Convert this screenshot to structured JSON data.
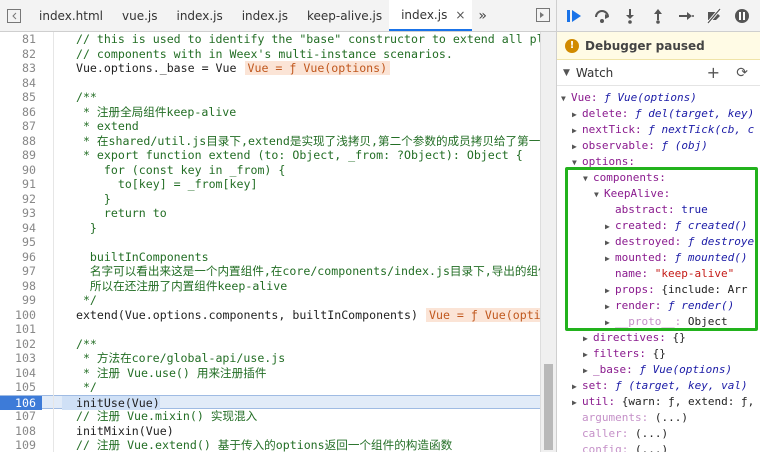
{
  "tabs": [
    {
      "label": "index.html",
      "active": false
    },
    {
      "label": "vue.js",
      "active": false
    },
    {
      "label": "index.js",
      "active": false
    },
    {
      "label": "index.js",
      "active": false
    },
    {
      "label": "keep-alive.js",
      "active": false
    },
    {
      "label": "index.js",
      "active": true
    }
  ],
  "tab_close": "×",
  "tab_more": "»",
  "code_lines": [
    {
      "n": "81",
      "text": "  // this is used to identify the \"base\" constructor to extend all plain-ob",
      "cls": "c-comment"
    },
    {
      "n": "82",
      "text": "  // components with in Weex's multi-instance scenarios.",
      "cls": "c-comment"
    },
    {
      "n": "83",
      "text": "  Vue.options._base = Vue",
      "cls": "",
      "inline": "Vue = ƒ Vue(options)"
    },
    {
      "n": "84",
      "text": "",
      "cls": ""
    },
    {
      "n": "85",
      "text": "  /**",
      "cls": "c-comment"
    },
    {
      "n": "86",
      "text": "   * 注册全局组件keep-alive",
      "cls": "c-comment"
    },
    {
      "n": "87",
      "text": "   * extend",
      "cls": "c-comment"
    },
    {
      "n": "88",
      "text": "   * 在shared/util.js目录下,extend是实现了浅拷贝,第二个参数的成员拷贝给了第一个参",
      "cls": "c-comment"
    },
    {
      "n": "89",
      "text": "   * export function extend (to: Object, _from: ?Object): Object {",
      "cls": "c-comment"
    },
    {
      "n": "90",
      "text": "      for (const key in _from) {",
      "cls": "c-comment"
    },
    {
      "n": "91",
      "text": "        to[key] = _from[key]",
      "cls": "c-comment"
    },
    {
      "n": "92",
      "text": "      }",
      "cls": "c-comment"
    },
    {
      "n": "93",
      "text": "      return to",
      "cls": "c-comment"
    },
    {
      "n": "94",
      "text": "    }",
      "cls": "c-comment"
    },
    {
      "n": "95",
      "text": "",
      "cls": ""
    },
    {
      "n": "96",
      "text": "    builtInComponents",
      "cls": "c-comment"
    },
    {
      "n": "97",
      "text": "    名字可以看出来这是一个内置组件,在core/components/index.js目录下,导出的组件其",
      "cls": "c-comment"
    },
    {
      "n": "98",
      "text": "    所以在还注册了内置组件keep-alive",
      "cls": "c-comment"
    },
    {
      "n": "99",
      "text": "   */",
      "cls": "c-comment"
    },
    {
      "n": "100",
      "text": "  extend(Vue.options.components, builtInComponents)",
      "cls": "",
      "inline": "Vue = ƒ Vue(options)"
    },
    {
      "n": "101",
      "text": "",
      "cls": ""
    },
    {
      "n": "102",
      "text": "  /**",
      "cls": "c-comment"
    },
    {
      "n": "103",
      "text": "   * 方法在core/global-api/use.js",
      "cls": "c-comment"
    },
    {
      "n": "104",
      "text": "   * 注册 Vue.use() 用来注册插件",
      "cls": "c-comment"
    },
    {
      "n": "105",
      "text": "   */",
      "cls": "c-comment"
    },
    {
      "n": "106",
      "text": "  initUse(Vue)",
      "cls": "",
      "hl": true
    },
    {
      "n": "107",
      "text": "  // 注册 Vue.mixin() 实现混入",
      "cls": "c-comment"
    },
    {
      "n": "108",
      "text": "  initMixin(Vue)",
      "cls": ""
    },
    {
      "n": "109",
      "text": "  // 注册 Vue.extend() 基于传入的options返回一个组件的构造函数",
      "cls": "c-comment"
    },
    {
      "n": "110",
      "text": "  initExtend(Vue)",
      "cls": ""
    }
  ],
  "debugger": {
    "paused_label": "Debugger paused",
    "watch_label": "Watch",
    "plus": "+",
    "refresh": "⟳"
  },
  "watch_tree": [
    {
      "indent": 0,
      "arrow": "▼",
      "key": "Vue:",
      "val": "ƒ Vue(options)",
      "valcls": "fn"
    },
    {
      "indent": 1,
      "arrow": "▶",
      "key": "delete:",
      "val": "ƒ del(target, key)",
      "valcls": "fn"
    },
    {
      "indent": 1,
      "arrow": "▶",
      "key": "nextTick:",
      "val": "ƒ nextTick(cb, c",
      "valcls": "fn"
    },
    {
      "indent": 1,
      "arrow": "▶",
      "key": "observable:",
      "val": "ƒ (obj)",
      "valcls": "fn"
    },
    {
      "indent": 1,
      "arrow": "▼",
      "key": "options:",
      "val": "",
      "valcls": "plain"
    },
    {
      "indent": 2,
      "arrow": "▼",
      "key": "components:",
      "val": "",
      "valcls": "plain"
    },
    {
      "indent": 3,
      "arrow": "▼",
      "key": "KeepAlive:",
      "val": "",
      "valcls": "plain"
    },
    {
      "indent": 4,
      "arrow": "",
      "key": "abstract:",
      "val": "true",
      "valcls": "b"
    },
    {
      "indent": 4,
      "arrow": "▶",
      "key": "created:",
      "val": "ƒ created()",
      "valcls": "fn"
    },
    {
      "indent": 4,
      "arrow": "▶",
      "key": "destroyed:",
      "val": "ƒ destroye",
      "valcls": "fn"
    },
    {
      "indent": 4,
      "arrow": "▶",
      "key": "mounted:",
      "val": "ƒ mounted()",
      "valcls": "fn"
    },
    {
      "indent": 4,
      "arrow": "",
      "key": "name:",
      "val": "\"keep-alive\"",
      "valcls": "s"
    },
    {
      "indent": 4,
      "arrow": "▶",
      "key": "props:",
      "val": "{include: Arr",
      "valcls": "plain"
    },
    {
      "indent": 4,
      "arrow": "▶",
      "key": "render:",
      "val": "ƒ render()",
      "valcls": "fn"
    },
    {
      "indent": 4,
      "arrow": "▶",
      "key": "__proto__:",
      "val": "Object",
      "valcls": "plain",
      "dim": true
    },
    {
      "indent": 2,
      "arrow": "▶",
      "key": "directives:",
      "val": "{}",
      "valcls": "plain"
    },
    {
      "indent": 2,
      "arrow": "▶",
      "key": "filters:",
      "val": "{}",
      "valcls": "plain"
    },
    {
      "indent": 2,
      "arrow": "▶",
      "key": "_base:",
      "val": "ƒ Vue(options)",
      "valcls": "fn"
    },
    {
      "indent": 1,
      "arrow": "▶",
      "key": "set:",
      "val": "ƒ (target, key, val)",
      "valcls": "fn"
    },
    {
      "indent": 1,
      "arrow": "▶",
      "key": "util:",
      "val": "{warn: ƒ, extend: ƒ,",
      "valcls": "plain"
    },
    {
      "indent": 1,
      "arrow": "",
      "key": "arguments:",
      "val": "(...)",
      "valcls": "plain",
      "dim": true
    },
    {
      "indent": 1,
      "arrow": "",
      "key": "caller:",
      "val": "(...)",
      "valcls": "plain",
      "dim": true
    },
    {
      "indent": 1,
      "arrow": "",
      "key": "config:",
      "val": "(...)",
      "valcls": "plain",
      "dim": true
    }
  ],
  "colors": {
    "accent": "#1a73e8",
    "highlight_box": "#22b21d",
    "inline_value_bg": "#fbe4d6"
  }
}
